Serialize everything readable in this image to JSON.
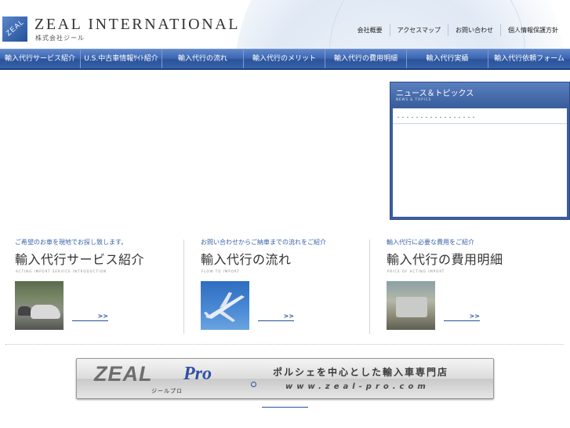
{
  "header": {
    "logo_text": "ZEAL",
    "brand": "ZEAL INTERNATIONAL",
    "brand_sub": "株式会社ジール",
    "toplinks": [
      "会社概要",
      "アクセスマップ",
      "お問い合わせ",
      "個人情報保護方針"
    ]
  },
  "nav": [
    "輸入代行サービス紹介",
    "U.S.中古車情報ｻｲﾄ紹介",
    "輸入代行の流れ",
    "輸入代行のメリット",
    "輸入代行の費用明細",
    "輸入代行実績",
    "輸入代行依頼フォーム"
  ],
  "news": {
    "title": "ニュース＆トピックス",
    "subtitle": "NEWS & TOPICS",
    "items": [
      "・・・・・・・・・・・・・・・・・"
    ]
  },
  "sections": [
    {
      "tag": "ご希望のお車を現地でお探し致します。",
      "title": "輸入代行サービス紹介",
      "en": "ACTING IMPORT SERVICE INTRODUCTION",
      "more": ">>"
    },
    {
      "tag": "お問い合わせからご納車までの流れをご紹介",
      "title": "輸入代行の流れ",
      "en": "FLOW TO IMPORT",
      "more": ">>"
    },
    {
      "tag": "輸入代行に必要な費用をご紹介",
      "title": "輸入代行の費用明細",
      "en": "PRICE OF ACTING IMPORT",
      "more": ">>"
    }
  ],
  "banner": {
    "logo": "ZEAL",
    "pro": "Pro",
    "kana": "ジールプロ",
    "catch": "ポルシェを中心とした輸入車専門店",
    "url": "www.zeal-pro.com"
  },
  "colors": {
    "nav_blue": "#3e68b3",
    "accent": "#3a63ab",
    "link": "#2a5099"
  }
}
